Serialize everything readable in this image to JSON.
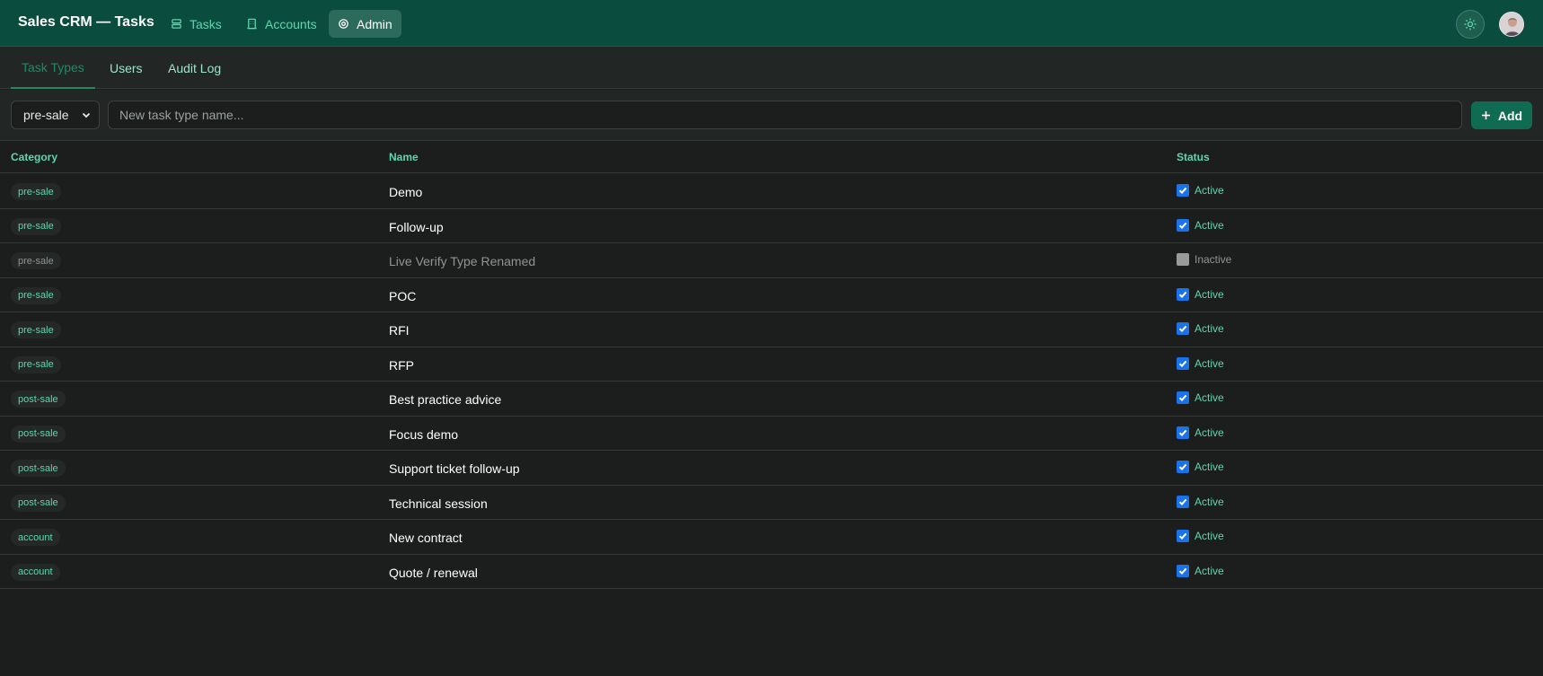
{
  "header": {
    "app_title": "Sales CRM — Tasks",
    "nav": [
      {
        "label": "Tasks",
        "icon": "layers-icon"
      },
      {
        "label": "Accounts",
        "icon": "building-icon"
      },
      {
        "label": "Admin",
        "icon": "gear-icon",
        "active": true
      }
    ],
    "theme_icon": "sun-icon",
    "avatar": "user-avatar"
  },
  "subtabs": [
    {
      "label": "Task Types",
      "active": true
    },
    {
      "label": "Users"
    },
    {
      "label": "Audit Log"
    }
  ],
  "toolbar": {
    "category_value": "pre-sale",
    "name_placeholder": "New task type name...",
    "add_label": "Add",
    "add_icon": "plus-icon"
  },
  "table": {
    "columns": [
      "Category",
      "Name",
      "Status"
    ],
    "rows": [
      {
        "category": "pre-sale",
        "name": "Demo",
        "active": true,
        "status": "Active"
      },
      {
        "category": "pre-sale",
        "name": "Follow-up",
        "active": true,
        "status": "Active"
      },
      {
        "category": "pre-sale",
        "name": "Live Verify Type Renamed",
        "active": false,
        "status": "Inactive"
      },
      {
        "category": "pre-sale",
        "name": "POC",
        "active": true,
        "status": "Active"
      },
      {
        "category": "pre-sale",
        "name": "RFI",
        "active": true,
        "status": "Active"
      },
      {
        "category": "pre-sale",
        "name": "RFP",
        "active": true,
        "status": "Active"
      },
      {
        "category": "post-sale",
        "name": "Best practice advice",
        "active": true,
        "status": "Active"
      },
      {
        "category": "post-sale",
        "name": "Focus demo",
        "active": true,
        "status": "Active"
      },
      {
        "category": "post-sale",
        "name": "Support ticket follow-up",
        "active": true,
        "status": "Active"
      },
      {
        "category": "post-sale",
        "name": "Technical session",
        "active": true,
        "status": "Active"
      },
      {
        "category": "account",
        "name": "New contract",
        "active": true,
        "status": "Active"
      },
      {
        "category": "account",
        "name": "Quote / renewal",
        "active": true,
        "status": "Active"
      }
    ]
  },
  "colors": {
    "header_bg": "#0a4d3e",
    "accent": "#5fd6ad",
    "primary_button": "#0f6b52",
    "checkbox_on": "#1a73e8"
  }
}
